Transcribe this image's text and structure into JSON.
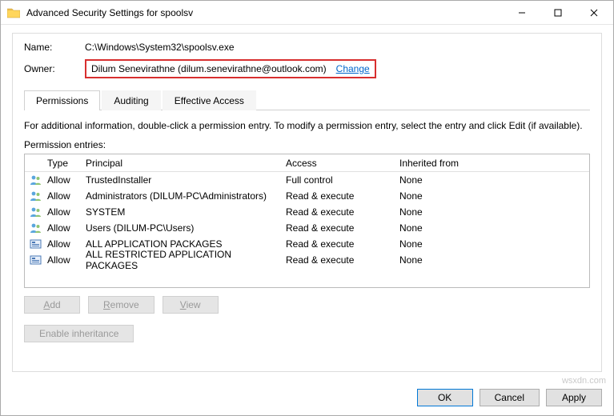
{
  "window": {
    "title": "Advanced Security Settings for spoolsv"
  },
  "labels": {
    "name": "Name:",
    "owner": "Owner:",
    "info": "For additional information, double-click a permission entry. To modify a permission entry, select the entry and click Edit (if available).",
    "entries": "Permission entries:"
  },
  "values": {
    "path": "C:\\Windows\\System32\\spoolsv.exe",
    "owner": "Dilum Senevirathne (dilum.senevirathne@outlook.com)",
    "change": "Change"
  },
  "tabs": [
    "Permissions",
    "Auditing",
    "Effective Access"
  ],
  "columns": {
    "type": "Type",
    "principal": "Principal",
    "access": "Access",
    "inherited": "Inherited from"
  },
  "entries": [
    {
      "icon": "people",
      "type": "Allow",
      "principal": "TrustedInstaller",
      "access": "Full control",
      "inherited": "None"
    },
    {
      "icon": "people",
      "type": "Allow",
      "principal": "Administrators (DILUM-PC\\Administrators)",
      "access": "Read & execute",
      "inherited": "None"
    },
    {
      "icon": "people",
      "type": "Allow",
      "principal": "SYSTEM",
      "access": "Read & execute",
      "inherited": "None"
    },
    {
      "icon": "people",
      "type": "Allow",
      "principal": "Users (DILUM-PC\\Users)",
      "access": "Read & execute",
      "inherited": "None"
    },
    {
      "icon": "pkg",
      "type": "Allow",
      "principal": "ALL APPLICATION PACKAGES",
      "access": "Read & execute",
      "inherited": "None"
    },
    {
      "icon": "pkg",
      "type": "Allow",
      "principal": "ALL RESTRICTED APPLICATION PACKAGES",
      "access": "Read & execute",
      "inherited": "None"
    }
  ],
  "actions": {
    "add": "Add",
    "remove": "Remove",
    "view": "View",
    "enable_inheritance": "Enable inheritance"
  },
  "footer": {
    "ok": "OK",
    "cancel": "Cancel",
    "apply": "Apply"
  },
  "watermark": "wsxdn.com"
}
